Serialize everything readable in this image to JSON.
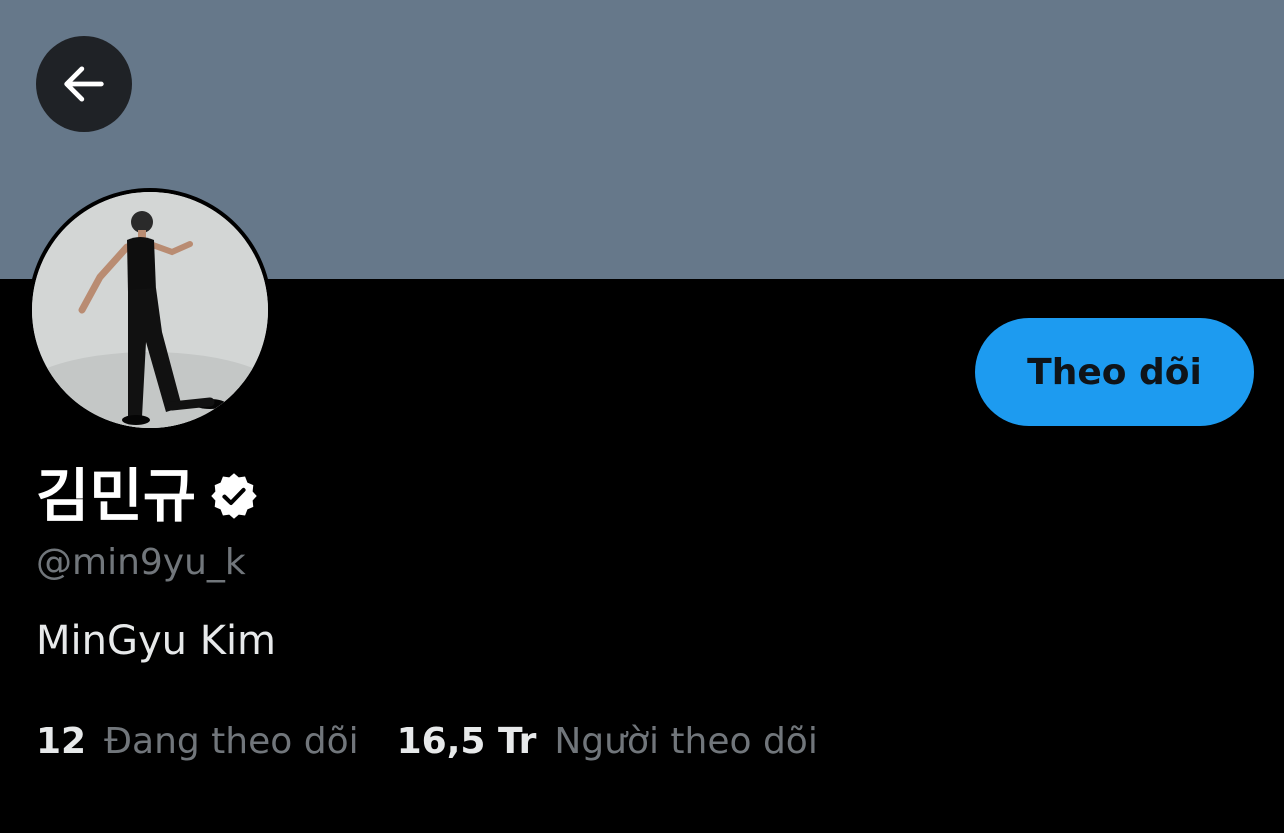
{
  "banner": {
    "color": "#66788a"
  },
  "nav": {
    "back_icon": "arrow-left-icon"
  },
  "profile": {
    "display_name": "김민규",
    "verified_icon": "verified-badge-icon",
    "handle": "@min9yu_k",
    "bio": "MinGyu Kim",
    "follow_label": "Theo dõi"
  },
  "stats": {
    "following_count": "12",
    "following_label": "Đang theo dõi",
    "followers_count": "16,5 Tr",
    "followers_label": "Người theo dõi"
  },
  "colors": {
    "accent": "#1d9bf0",
    "secondary_text": "#71767b",
    "background": "#000000"
  }
}
